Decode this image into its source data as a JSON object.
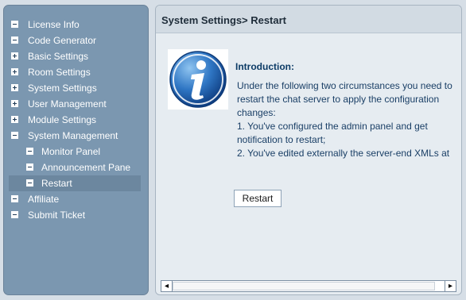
{
  "sidebar": {
    "items": [
      {
        "label": "License Info",
        "icon": "minus-icon"
      },
      {
        "label": "Code Generator",
        "icon": "minus-icon"
      },
      {
        "label": "Basic Settings",
        "icon": "plus-icon"
      },
      {
        "label": "Room Settings",
        "icon": "plus-icon"
      },
      {
        "label": "System Settings",
        "icon": "plus-icon"
      },
      {
        "label": "User Management",
        "icon": "plus-icon"
      },
      {
        "label": "Module Settings",
        "icon": "plus-icon"
      },
      {
        "label": "System Management",
        "icon": "minus-icon"
      },
      {
        "label": "Monitor Panel",
        "icon": "minus-icon"
      },
      {
        "label": "Announcement Pane",
        "icon": "minus-icon"
      },
      {
        "label": "Restart",
        "icon": "minus-icon",
        "active": true
      },
      {
        "label": "Affiliate",
        "icon": "minus-icon"
      },
      {
        "label": "Submit Ticket",
        "icon": "minus-icon"
      }
    ]
  },
  "header": {
    "section": "System Settings",
    "page": "> Restart"
  },
  "content": {
    "intro_title": "Introduction:",
    "intro_lines": [
      "Under the following two circumstances you need to",
      "restart the chat server to apply the configuration",
      "changes:",
      "1. You've configured the admin panel and get",
      "notification to restart;",
      "2. You've edited externally the server-end XMLs at"
    ],
    "restart_button": "Restart"
  },
  "scrollbar": {
    "left_arrow": "◂",
    "right_arrow": "▸"
  },
  "colors": {
    "sidebar_bg": "#7b97b0",
    "main_bg": "#e6ecf1",
    "header_bg": "#d2dbe3",
    "intro_text": "#1a3f66"
  }
}
